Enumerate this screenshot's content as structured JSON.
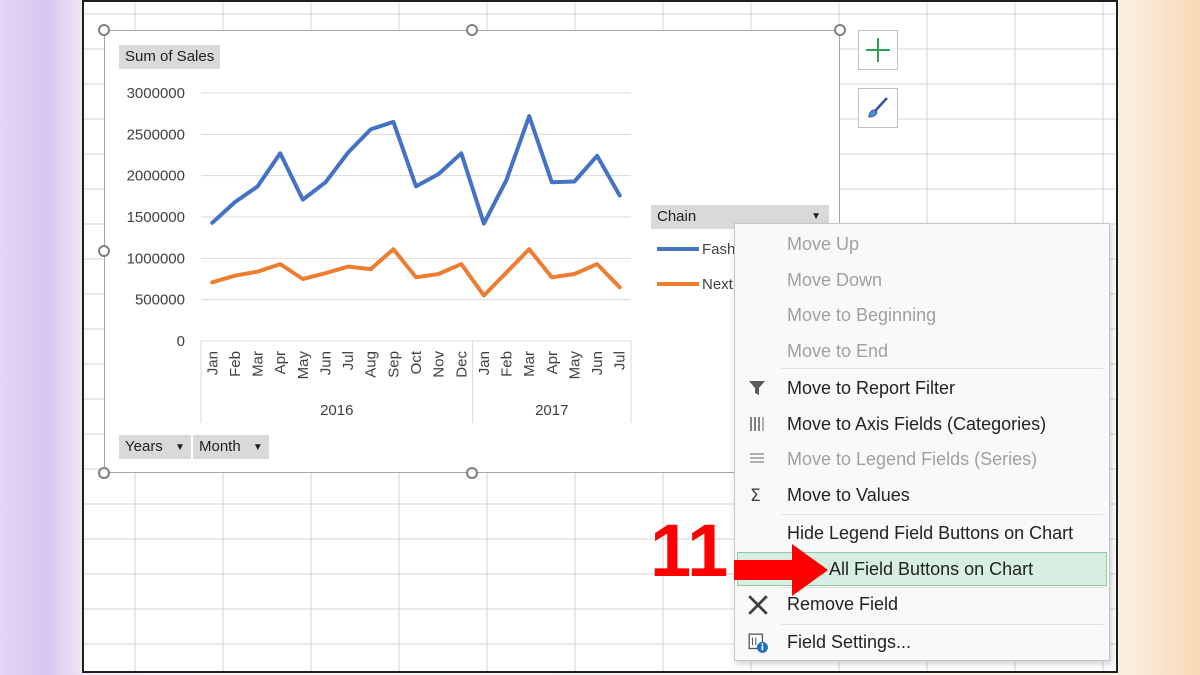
{
  "chart_data": {
    "type": "line",
    "title": "",
    "xlabel": "",
    "ylabel": "",
    "ylim": [
      0,
      3000000
    ],
    "y_ticks": [
      "3000000",
      "2500000",
      "2000000",
      "1500000",
      "1000000",
      "500000",
      "0"
    ],
    "y_tick_values": [
      3000000,
      2500000,
      2000000,
      1500000,
      1000000,
      500000,
      0
    ],
    "categories": [
      "Jan",
      "Feb",
      "Mar",
      "Apr",
      "May",
      "Jun",
      "Jul",
      "Aug",
      "Sep",
      "Oct",
      "Nov",
      "Dec",
      "Jan",
      "Feb",
      "Mar",
      "Apr",
      "May",
      "Jun",
      "Jul"
    ],
    "year_groups": [
      {
        "label": "2016",
        "count": 12
      },
      {
        "label": "2017",
        "count": 7
      }
    ],
    "series": [
      {
        "name": "Fashion",
        "legend_label": "Fash",
        "color": "#4472c4",
        "values": [
          1430000,
          1680000,
          1870000,
          2270000,
          1710000,
          1920000,
          2280000,
          2560000,
          2650000,
          1870000,
          2020000,
          2270000,
          1420000,
          1950000,
          2720000,
          1920000,
          1930000,
          2240000,
          1760000
        ]
      },
      {
        "name": "Next",
        "legend_label": "Next",
        "color": "#ed7d31",
        "values": [
          710000,
          790000,
          840000,
          930000,
          750000,
          820000,
          900000,
          870000,
          1110000,
          770000,
          810000,
          930000,
          550000,
          830000,
          1110000,
          770000,
          810000,
          930000,
          650000
        ]
      }
    ],
    "grid": true,
    "legend_position": "right"
  },
  "field_buttons": {
    "value_field": "Sum of Sales",
    "legend_field": "Chain",
    "axis_fields": [
      "Years",
      "Month"
    ]
  },
  "side_buttons": {
    "add_element_icon": "plus-icon",
    "style_icon": "paintbrush-icon"
  },
  "context_menu": {
    "items": [
      {
        "label": "Move Up",
        "disabled": true,
        "icon": ""
      },
      {
        "label": "Move Down",
        "disabled": true,
        "icon": ""
      },
      {
        "label": "Move to Beginning",
        "disabled": true,
        "icon": ""
      },
      {
        "label": "Move to End",
        "disabled": true,
        "icon": ""
      },
      {
        "label": "Move to Report Filter",
        "disabled": false,
        "icon": "filter-icon"
      },
      {
        "label": "Move to Axis Fields (Categories)",
        "disabled": false,
        "icon": "axis-fields-icon"
      },
      {
        "label": "Move to Legend Fields (Series)",
        "disabled": true,
        "icon": "legend-fields-icon"
      },
      {
        "label": "Move to Values",
        "disabled": false,
        "icon": "sigma-icon"
      },
      {
        "label": "Hide Legend Field Buttons on Chart",
        "disabled": false,
        "icon": ""
      },
      {
        "label": "Hide All Field Buttons on Chart",
        "disabled": false,
        "icon": "",
        "highlighted": true
      },
      {
        "label": "Remove Field",
        "disabled": false,
        "icon": "remove-icon"
      },
      {
        "label": "Field Settings...",
        "disabled": false,
        "icon": "field-settings-icon"
      }
    ]
  },
  "annotation": {
    "step_number": "11",
    "color": "#ff0000"
  }
}
